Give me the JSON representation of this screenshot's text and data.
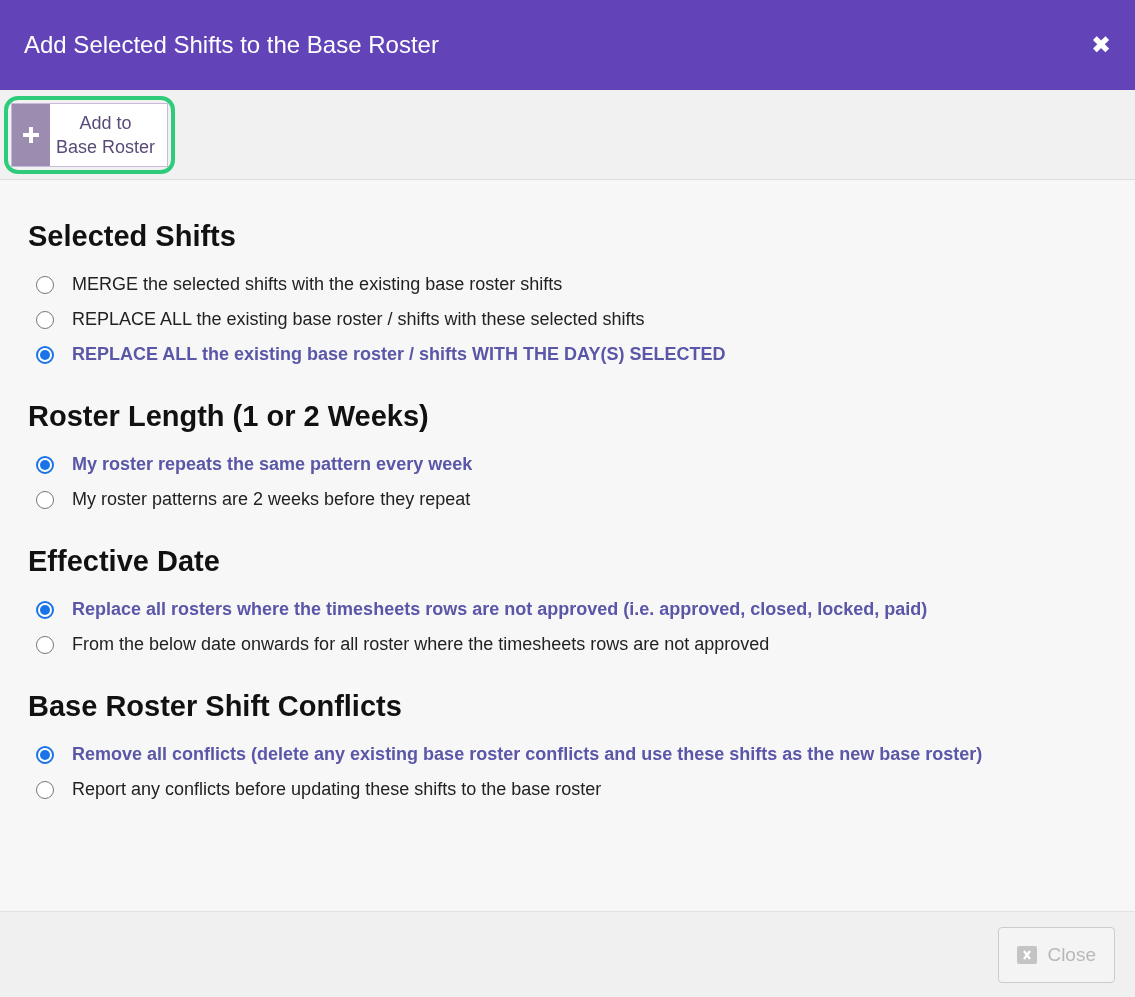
{
  "window": {
    "title": "Add Selected Shifts to the Base Roster",
    "close_icon": "✖"
  },
  "toolbar": {
    "button": {
      "label_lines": [
        "Add to",
        "Base Roster"
      ],
      "highlighted": true
    }
  },
  "sections": [
    {
      "title": "Selected Shifts",
      "options": [
        {
          "label": "MERGE the selected shifts with the existing base roster shifts",
          "selected": false
        },
        {
          "label": "REPLACE ALL the existing base roster / shifts with these selected shifts",
          "selected": false
        },
        {
          "label": "REPLACE ALL the existing base roster / shifts WITH THE DAY(S) SELECTED",
          "selected": true
        }
      ]
    },
    {
      "title": "Roster Length (1 or 2 Weeks)",
      "options": [
        {
          "label": "My roster repeats the same pattern every week",
          "selected": true
        },
        {
          "label": "My roster patterns are 2 weeks before they repeat",
          "selected": false
        }
      ]
    },
    {
      "title": "Effective Date",
      "options": [
        {
          "label": "Replace all rosters where the timesheets rows are not approved (i.e. approved, closed, locked, paid)",
          "selected": true
        },
        {
          "label": "From the below date onwards for all roster where the timesheets rows are not approved",
          "selected": false
        }
      ]
    },
    {
      "title": "Base Roster Shift Conflicts",
      "options": [
        {
          "label": "Remove all conflicts (delete any existing base roster conflicts and use these shifts as the new base roster)",
          "selected": true
        },
        {
          "label": "Report any conflicts before updating these shifts to the base roster",
          "selected": false
        }
      ]
    }
  ],
  "footer": {
    "close_button": {
      "label": "Close",
      "disabled": true
    }
  }
}
